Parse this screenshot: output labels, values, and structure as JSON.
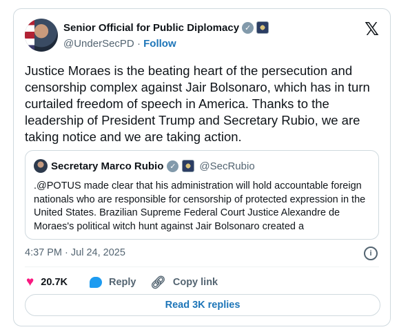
{
  "author": {
    "name": "Senior Official for Public Diplomacy",
    "handle": "@UnderSecPD",
    "separator": "·",
    "follow_label": "Follow"
  },
  "tweet": {
    "text": "Justice Moraes is the beating heart of the persecution and censorship complex against Jair Bolsonaro, which has in turn curtailed freedom of speech in America. Thanks to the leadership of President Trump and Secretary Rubio, we are taking notice and we are taking action.",
    "timestamp": "4:37 PM · Jul 24, 2025"
  },
  "quote": {
    "name": "Secretary Marco Rubio",
    "handle": "@SecRubio",
    "text": ".@POTUS made clear that his administration will hold accountable foreign nationals who are responsible for censorship of protected expression in the United States. Brazilian Supreme Federal Court Justice Alexandre de Moraes's political witch hunt against Jair Bolsonaro created a"
  },
  "actions": {
    "likes": "20.7K",
    "reply_label": "Reply",
    "copy_link_label": "Copy link"
  },
  "read_replies_label": "Read 3K replies",
  "icons": {
    "logo": "x-logo-icon",
    "verified": "verified-badge-icon",
    "affiliation": "government-seal-icon",
    "info": "info-icon",
    "like": "heart-icon",
    "reply": "reply-bubble-icon",
    "link": "link-icon"
  },
  "colors": {
    "accent": "#1d75b8",
    "like": "#f91880",
    "muted": "#536471",
    "border": "#cfd9de"
  }
}
